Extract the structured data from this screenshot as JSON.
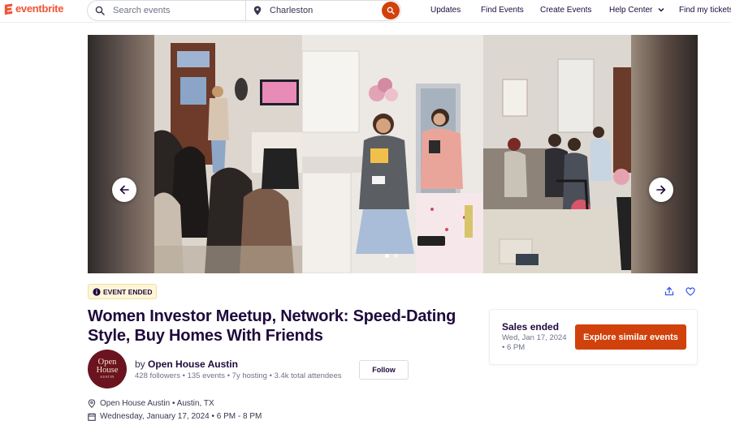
{
  "header": {
    "logo": "eventbrite",
    "search_placeholder": "Search events",
    "location": "Charleston",
    "nav": [
      "Updates",
      "Find Events",
      "Create Events",
      "Help Center",
      "Find my tickets"
    ]
  },
  "carousel": {
    "slide_count": 2,
    "active_slide": 0
  },
  "event": {
    "status_badge": "EVENT ENDED",
    "title": "Women Investor Meetup, Network: Speed-Dating Style, Buy Homes With Friends",
    "organizer_prefix": "by",
    "organizer_name": "Open House Austin",
    "organizer_stats": "428 followers • 135 events • 7y hosting • 3.4k total attendees",
    "follow_label": "Follow",
    "avatar_text_line1": "Open",
    "avatar_text_line2": "House",
    "avatar_text_line3": "AUSTIN",
    "location": "Open House Austin • Austin, TX",
    "datetime": "Wednesday, January 17, 2024 • 6 PM - 8 PM"
  },
  "sales": {
    "title": "Sales ended",
    "date": "Wed, Jan 17, 2024 • 6 PM",
    "cta": "Explore similar events"
  },
  "colors": {
    "brand": "#f05537",
    "cta": "#d1410c",
    "text": "#1e0a3c",
    "badge_bg": "#fff6d8"
  }
}
